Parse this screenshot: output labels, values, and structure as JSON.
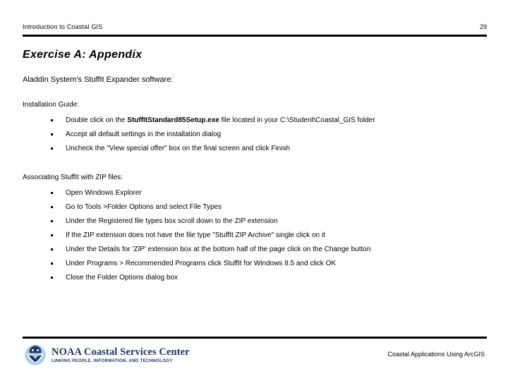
{
  "header": {
    "title": "Introduction to Coastal GIS",
    "page_number": "29"
  },
  "title": "Exercise A: Appendix",
  "lead": "Aladdin System's StuffIt Expander software:",
  "sections": [
    {
      "heading": "Installation Guide:",
      "bullets": [
        {
          "pre": "Double click on the ",
          "bold": "StuffItStandard85Setup.exe",
          "post": " file located in your C:\\Student\\Coastal_GIS folder"
        },
        {
          "pre": "Accept all default settings in the installation dialog",
          "bold": "",
          "post": ""
        },
        {
          "pre": "Uncheck the \"View special offer\" box on the final screen and click Finish",
          "bold": "",
          "post": ""
        }
      ]
    },
    {
      "heading": "Associating StuffIt with ZIP files:",
      "bullets": [
        {
          "pre": "Open Windows Explorer",
          "bold": "",
          "post": ""
        },
        {
          "pre": "Go to Tools >Folder Options and select File Types",
          "bold": "",
          "post": ""
        },
        {
          "pre": "Under the Registered file types box scroll down to the ZIP extension",
          "bold": "",
          "post": ""
        },
        {
          "pre": "If the ZIP extension does not have the file type \"StuffIt ZIP Archive\" single click on it",
          "bold": "",
          "post": ""
        },
        {
          "pre": "Under the Details for 'ZIP' extension box at the bottom half of the page click on the Change button",
          "bold": "",
          "post": ""
        },
        {
          "pre": "Under Programs > Recommended Programs click StuffIt for Windows 8.5 and click OK",
          "bold": "",
          "post": ""
        },
        {
          "pre": "Close the Folder Options dialog box",
          "bold": "",
          "post": ""
        }
      ]
    }
  ],
  "footer": {
    "logo_name": "NOAA Coastal Services Center",
    "logo_tagline": "LINKING PEOPLE, INFORMATION, AND TECHNOLOGY",
    "right_text": "Coastal Applications Using ArcGIS",
    "logo_colors": {
      "circle": "#a9cfe6",
      "mark": "#1c3461",
      "text": "#1c3461"
    }
  },
  "colors": {
    "background": "#ffffff",
    "text": "#000000",
    "rule": "#000000"
  }
}
